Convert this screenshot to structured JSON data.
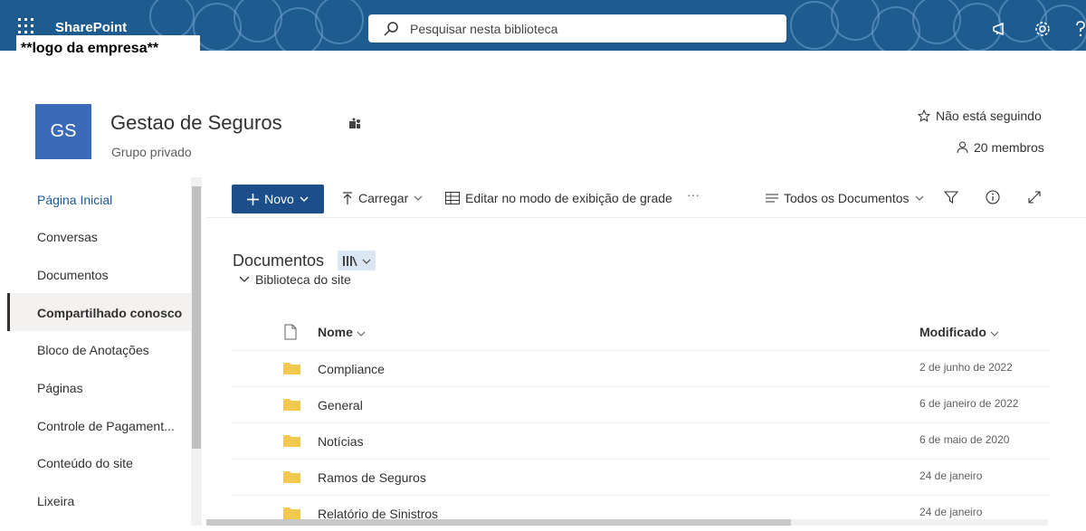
{
  "topbar": {
    "app_name": "SharePoint",
    "search_placeholder": "Pesquisar nesta biblioteca",
    "logo_text": "**logo da empresa**",
    "color": "#1e5b8f"
  },
  "site": {
    "initials": "GS",
    "title": "Gestao de Seguros",
    "subtitle": "Grupo privado",
    "follow_label": "Não está seguindo",
    "members_label": "20 membros",
    "logo_color": "#3a6ab8"
  },
  "nav": {
    "items": [
      {
        "label": "Página Inicial"
      },
      {
        "label": "Conversas"
      },
      {
        "label": "Documentos"
      },
      {
        "label": "Compartilhado conosco"
      },
      {
        "label": "Bloco de Anotações"
      },
      {
        "label": "Páginas"
      },
      {
        "label": "Controle de Pagament..."
      },
      {
        "label": "Conteúdo do site"
      },
      {
        "label": "Lixeira"
      }
    ]
  },
  "commandbar": {
    "new_label": "Novo",
    "upload_label": "Carregar",
    "grid_edit_label": "Editar no modo de exibição de grade",
    "more_label": "···",
    "view_label": "Todos os Documentos",
    "button_color": "#1c4f8a"
  },
  "library": {
    "title": "Documentos",
    "subtitle": "Biblioteca do site",
    "columns": {
      "name": "Nome",
      "modified": "Modificado"
    },
    "rows": [
      {
        "name": "Compliance",
        "modified": "2 de junho de 2022"
      },
      {
        "name": "General",
        "modified": "6 de janeiro de 2022"
      },
      {
        "name": "Notícias",
        "modified": "6 de maio de 2020"
      },
      {
        "name": "Ramos de Seguros",
        "modified": "24 de janeiro"
      },
      {
        "name": "Relatório de Sinistros",
        "modified": "24 de janeiro"
      }
    ]
  }
}
